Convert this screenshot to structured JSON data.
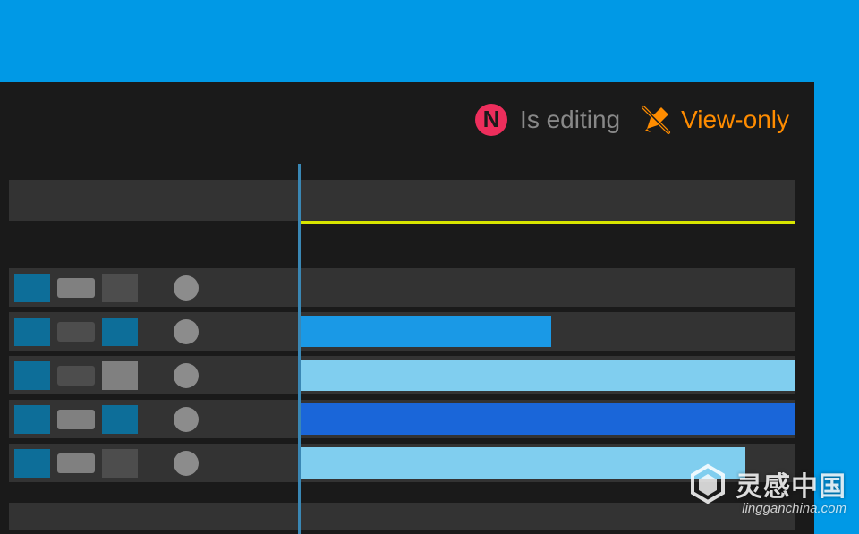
{
  "header": {
    "presence_initial": "N",
    "presence_label": "Is editing",
    "mode_label": "View-only"
  },
  "colors": {
    "bg_outer": "#0099e6",
    "panel": "#1a1a1a",
    "row": "#333333",
    "playhead": "#3a87b4",
    "in_point": "#d8e600",
    "avatar": "#ed2e5c",
    "accent": "#ff8c00",
    "clip_blue": "#1a99e6",
    "clip_light": "#80ceef",
    "clip_deep": "#1a66d9"
  },
  "tracks": [
    {
      "toggles": {
        "a": "blue-on",
        "b": "grey-on",
        "c": "grey-dim"
      },
      "circle": true,
      "clip": null
    },
    {
      "toggles": {
        "a": "blue-on",
        "b": "grey-dim",
        "c": "blue-on"
      },
      "circle": true,
      "clip": {
        "start_pct": 0,
        "end_pct": 51,
        "color": "clip_blue"
      }
    },
    {
      "toggles": {
        "a": "blue-on",
        "b": "grey-dim",
        "c": "grey-on"
      },
      "circle": true,
      "clip": {
        "start_pct": 0,
        "end_pct": 100,
        "color": "clip_light"
      }
    },
    {
      "toggles": {
        "a": "blue-on",
        "b": "grey-on",
        "c": "blue-on"
      },
      "circle": true,
      "clip": {
        "start_pct": 0,
        "end_pct": 100,
        "color": "clip_deep"
      }
    },
    {
      "toggles": {
        "a": "blue-on",
        "b": "grey-on",
        "c": "grey-dim"
      },
      "circle": true,
      "clip": {
        "start_pct": 0,
        "end_pct": 90,
        "color": "clip_light"
      }
    }
  ],
  "watermark": {
    "main": "灵感中国",
    "sub": "lingganchina",
    "domain": ".com"
  }
}
